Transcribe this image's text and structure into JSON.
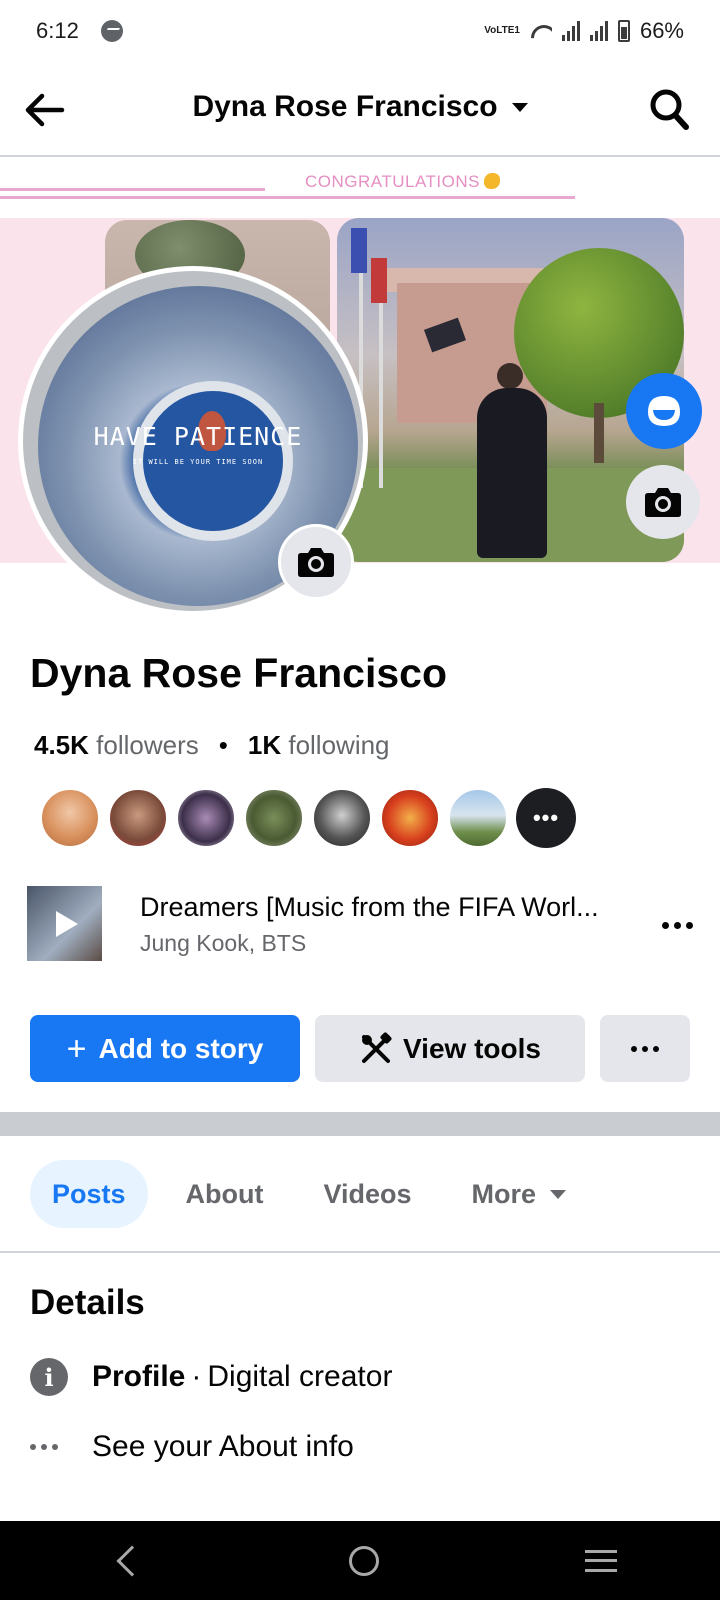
{
  "status_bar": {
    "time": "6:12",
    "volte_label": "VoLTE1",
    "battery": "66%"
  },
  "header": {
    "title": "Dyna Rose Francisco",
    "back_icon": "arrow-left-icon",
    "search_icon": "search-icon"
  },
  "cover": {
    "banner_text": "CONGRATULATIONS",
    "avatar_text": "HAVE PATIENCE",
    "avatar_subtext": "IT WILL BE YOUR TIME SOON"
  },
  "profile": {
    "name": "Dyna Rose Francisco",
    "followers_count": "4.5K",
    "followers_label": "followers",
    "separator": "•",
    "following_count": "1K",
    "following_label": "following",
    "followers_more": "•••"
  },
  "music": {
    "title": "Dreamers [Music from the FIFA Worl...",
    "artist": "Jung Kook, BTS"
  },
  "actions": {
    "add_story": "Add to story",
    "view_tools": "View tools"
  },
  "tabs": [
    {
      "label": "Posts",
      "active": true
    },
    {
      "label": "About",
      "active": false
    },
    {
      "label": "Videos",
      "active": false
    },
    {
      "label": "More",
      "active": false
    }
  ],
  "details": {
    "title": "Details",
    "profile_label": "Profile",
    "profile_sep": "·",
    "profile_value": "Digital creator",
    "about_link": "See your About info"
  },
  "colors": {
    "accent": "#1877f2",
    "tab_active_bg": "#e7f3ff",
    "secondary_button": "#e4e6eb",
    "muted_text": "#65676b"
  }
}
